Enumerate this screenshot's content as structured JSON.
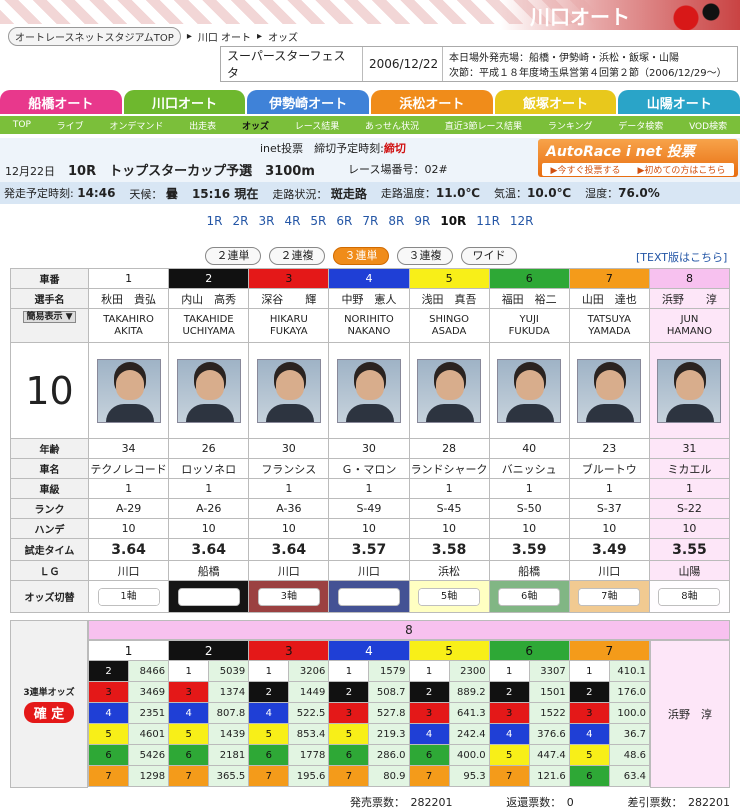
{
  "header": {
    "brand": "川口オート",
    "breadcrumb": [
      "オートレースネットスタジアムTOP",
      "川口 オート",
      "オッズ"
    ]
  },
  "event": {
    "name": "スーパースターフェスタ",
    "date": "2006/12/22",
    "line1": "本日場外発売場：船橋・伊勢崎・浜松・飯塚・山陽",
    "line2": "次節：平成１８年度埼玉県営第４回第２節（2006/12/29～）"
  },
  "venues": [
    {
      "label": "船橋オート",
      "color": "#e8388c"
    },
    {
      "label": "川口オート",
      "color": "#6eb82e"
    },
    {
      "label": "伊勢崎オート",
      "color": "#3f82d8"
    },
    {
      "label": "浜松オート",
      "color": "#f08c1a"
    },
    {
      "label": "飯塚オート",
      "color": "#e8c81c"
    },
    {
      "label": "山陽オート",
      "color": "#2aa4c8"
    }
  ],
  "subnav": [
    "TOP",
    "ライブ",
    "オンデマンド",
    "出走表",
    "オッズ",
    "レース結果",
    "あっせん状況",
    "直近3節レース結果",
    "ランキング",
    "データ検索",
    "VOD検索"
  ],
  "race": {
    "inet": "inet投票　締切予定時刻:",
    "closed": "締切",
    "date": "12月22日",
    "no": "10R",
    "title": "トップスターカップ予選",
    "distance": "3100m",
    "race_no_label": "レース場番号：02#"
  },
  "autorace": {
    "title": "AutoRace i net 投票",
    "btn1": "▶今すぐ投票する",
    "btn2": "▶初めての方はこちら"
  },
  "conditions": {
    "start_label": "発走予定時刻:",
    "start": "14:46",
    "weather_label": "天候：",
    "weather": "曇",
    "now": "15:16 現在",
    "track_label": "走路状況：",
    "track": "斑走路",
    "temp_label": "走路温度：",
    "temp": "11.0℃",
    "air_label": "気温：",
    "air": "10.0℃",
    "hum_label": "湿度：",
    "hum": "76.0%"
  },
  "race_links": [
    "1R",
    "2R",
    "3R",
    "4R",
    "5R",
    "6R",
    "7R",
    "8R",
    "9R",
    "10R",
    "11R",
    "12R"
  ],
  "bet_types": [
    "２連単",
    "２連複",
    "３連単",
    "３連複",
    "ワイド"
  ],
  "text_link": "[TEXT版はこちら]",
  "labels": {
    "car": "車番",
    "name": "選手名",
    "display": "簡易表示 ▼",
    "age": "年齢",
    "bike": "車名",
    "class": "車級",
    "rank": "ランク",
    "handicap": "ハンデ",
    "trial": "試走タイム",
    "lg": "ＬＧ",
    "odds_switch": "オッズ切替",
    "race_big": "10",
    "odds_title": "3連単オッズ",
    "kakutei": "確 定"
  },
  "riders": [
    {
      "car": "1",
      "name": "秋田　貴弘",
      "roman": [
        "TAKAHIRO",
        "AKITA"
      ],
      "age": "34",
      "bike": "テクノレコード",
      "class": "1",
      "rank": "A-29",
      "hc": "10",
      "trial": "3.64",
      "lg": "川口",
      "axis": "1軸"
    },
    {
      "car": "2",
      "name": "内山　高秀",
      "roman": [
        "TAKAHIDE",
        "UCHIYAMA"
      ],
      "age": "26",
      "bike": "ロッソネロ",
      "class": "1",
      "rank": "A-26",
      "hc": "10",
      "trial": "3.64",
      "lg": "船橋",
      "axis": "2軸"
    },
    {
      "car": "3",
      "name": "深谷　　輝",
      "roman": [
        "HIKARU",
        "FUKAYA"
      ],
      "age": "30",
      "bike": "フランシス",
      "class": "1",
      "rank": "A-36",
      "hc": "10",
      "trial": "3.64",
      "lg": "川口",
      "axis": "3軸"
    },
    {
      "car": "4",
      "name": "中野　憲人",
      "roman": [
        "NORIHITO",
        "NAKANO"
      ],
      "age": "30",
      "bike": "Ｇ・マロン",
      "class": "1",
      "rank": "S-49",
      "hc": "10",
      "trial": "3.57",
      "lg": "川口",
      "axis": "4軸"
    },
    {
      "car": "5",
      "name": "浅田　真吾",
      "roman": [
        "SHINGO",
        "ASADA"
      ],
      "age": "28",
      "bike": "ランドシャーク",
      "class": "1",
      "rank": "S-45",
      "hc": "10",
      "trial": "3.58",
      "lg": "浜松",
      "axis": "5軸"
    },
    {
      "car": "6",
      "name": "福田　裕二",
      "roman": [
        "YUJI",
        "FUKUDA"
      ],
      "age": "40",
      "bike": "バニッシュ",
      "class": "1",
      "rank": "S-50",
      "hc": "10",
      "trial": "3.59",
      "lg": "船橋",
      "axis": "6軸"
    },
    {
      "car": "7",
      "name": "山田　達也",
      "roman": [
        "TATSUYA",
        "YAMADA"
      ],
      "age": "23",
      "bike": "ブルートウ",
      "class": "1",
      "rank": "S-37",
      "hc": "10",
      "trial": "3.49",
      "lg": "川口",
      "axis": "7軸"
    },
    {
      "car": "8",
      "name": "浜野　　淳",
      "roman": [
        "JUN",
        "HAMANO"
      ],
      "age": "31",
      "bike": "ミカエル",
      "class": "1",
      "rank": "S-22",
      "hc": "10",
      "trial": "3.55",
      "lg": "山陽",
      "axis": "8軸"
    }
  ],
  "odds": {
    "first": "8",
    "second_cols": [
      "1",
      "2",
      "3",
      "4",
      "5",
      "6",
      "7"
    ],
    "rows": [
      [
        [
          "2",
          "8466"
        ],
        [
          "1",
          "5039"
        ],
        [
          "1",
          "3206"
        ],
        [
          "1",
          "1579"
        ],
        [
          "1",
          "2300"
        ],
        [
          "1",
          "3307"
        ],
        [
          "1",
          "410.1"
        ]
      ],
      [
        [
          "3",
          "3469"
        ],
        [
          "3",
          "1374"
        ],
        [
          "2",
          "1449"
        ],
        [
          "2",
          "508.7"
        ],
        [
          "2",
          "889.2"
        ],
        [
          "2",
          "1501"
        ],
        [
          "2",
          "176.0"
        ]
      ],
      [
        [
          "4",
          "2351"
        ],
        [
          "4",
          "807.8"
        ],
        [
          "4",
          "522.5"
        ],
        [
          "3",
          "527.8"
        ],
        [
          "3",
          "641.3"
        ],
        [
          "3",
          "1522"
        ],
        [
          "3",
          "100.0"
        ]
      ],
      [
        [
          "5",
          "4601"
        ],
        [
          "5",
          "1439"
        ],
        [
          "5",
          "853.4"
        ],
        [
          "5",
          "219.3"
        ],
        [
          "4",
          "242.4"
        ],
        [
          "4",
          "376.6"
        ],
        [
          "4",
          "36.7"
        ]
      ],
      [
        [
          "6",
          "5426"
        ],
        [
          "6",
          "2181"
        ],
        [
          "6",
          "1778"
        ],
        [
          "6",
          "286.0"
        ],
        [
          "6",
          "400.0"
        ],
        [
          "5",
          "447.4"
        ],
        [
          "5",
          "48.6"
        ]
      ],
      [
        [
          "7",
          "1298"
        ],
        [
          "7",
          "365.5"
        ],
        [
          "7",
          "195.6"
        ],
        [
          "7",
          "80.9"
        ],
        [
          "7",
          "95.3"
        ],
        [
          "7",
          "121.6"
        ],
        [
          "6",
          "63.4"
        ]
      ]
    ],
    "rider8": "浜野　淳"
  },
  "totals": {
    "sold": "発売票数：　282201",
    "refund": "返還票数：　0",
    "net": "差引票数：　282201"
  }
}
